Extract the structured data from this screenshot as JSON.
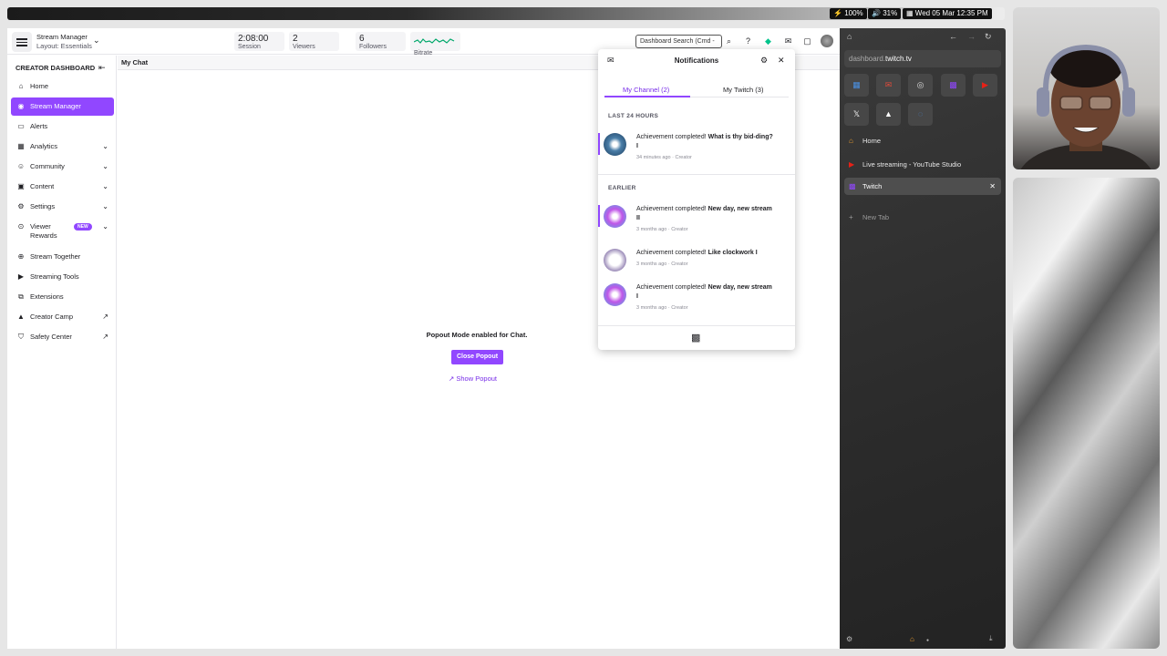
{
  "system_bar": {
    "battery": "100%",
    "volume": "31%",
    "datetime": "Wed 05 Mar 12:35 PM"
  },
  "topbar": {
    "layout_title": "Stream Manager",
    "layout_sub": "Layout: Essentials",
    "stats": [
      {
        "value": "2:08:00",
        "label": "Session"
      },
      {
        "value": "2",
        "label": "Viewers"
      },
      {
        "value": "6",
        "label": "Followers"
      },
      {
        "value": "",
        "label": "Bitrate"
      }
    ],
    "search_placeholder": "Dashboard Search (Cmd -"
  },
  "sidebar": {
    "heading": "CREATOR DASHBOARD",
    "items": [
      {
        "label": "Home",
        "icon": "home-icon"
      },
      {
        "label": "Stream Manager",
        "icon": "broadcast-icon"
      },
      {
        "label": "Alerts",
        "icon": "alerts-icon"
      },
      {
        "label": "Analytics",
        "icon": "analytics-icon"
      },
      {
        "label": "Community",
        "icon": "community-icon"
      },
      {
        "label": "Content",
        "icon": "content-icon"
      },
      {
        "label": "Settings",
        "icon": "settings-icon"
      },
      {
        "label": "Viewer Rewards",
        "icon": "rewards-icon"
      },
      {
        "label": "Stream Together",
        "icon": "stream-together-icon"
      },
      {
        "label": "Streaming Tools",
        "icon": "camera-icon"
      },
      {
        "label": "Extensions",
        "icon": "extensions-icon"
      },
      {
        "label": "Creator Camp",
        "icon": "camp-icon"
      },
      {
        "label": "Safety Center",
        "icon": "shield-icon"
      }
    ],
    "new_badge": "NEW"
  },
  "chat": {
    "header": "My Chat",
    "popout_message": "Popout Mode enabled for Chat.",
    "close_popout": "Close Popout",
    "show_popout": "Show Popout"
  },
  "notifications": {
    "title": "Notifications",
    "tabs": [
      "My Channel (2)",
      "My Twitch (3)"
    ],
    "section_recent": "LAST 24 HOURS",
    "section_earlier": "EARLIER",
    "items": [
      {
        "prefix": "Achievement completed! ",
        "bold": "What is thy bid-ding? I",
        "meta": "34 minutes ago · Creator"
      },
      {
        "prefix": "Achievement completed! ",
        "bold": "New day, new stream II",
        "meta": "3 months ago · Creator"
      },
      {
        "prefix": "Achievement completed! ",
        "bold": "Like clockwork I",
        "meta": "3 months ago · Creator"
      },
      {
        "prefix": "Achievement completed! ",
        "bold": "New day, new stream I",
        "meta": "3 months ago · Creator"
      }
    ]
  },
  "browser": {
    "url_domain": "dashboard.",
    "url_host": "twitch.tv",
    "tabs": [
      {
        "label": "Home"
      },
      {
        "label": "Live streaming - YouTube Studio"
      },
      {
        "label": "Twitch"
      }
    ],
    "new_tab": "New Tab"
  },
  "colors": {
    "accent": "#9147ff",
    "accent_text": "#772ce8",
    "browser_bg": "#2b2b2b"
  }
}
